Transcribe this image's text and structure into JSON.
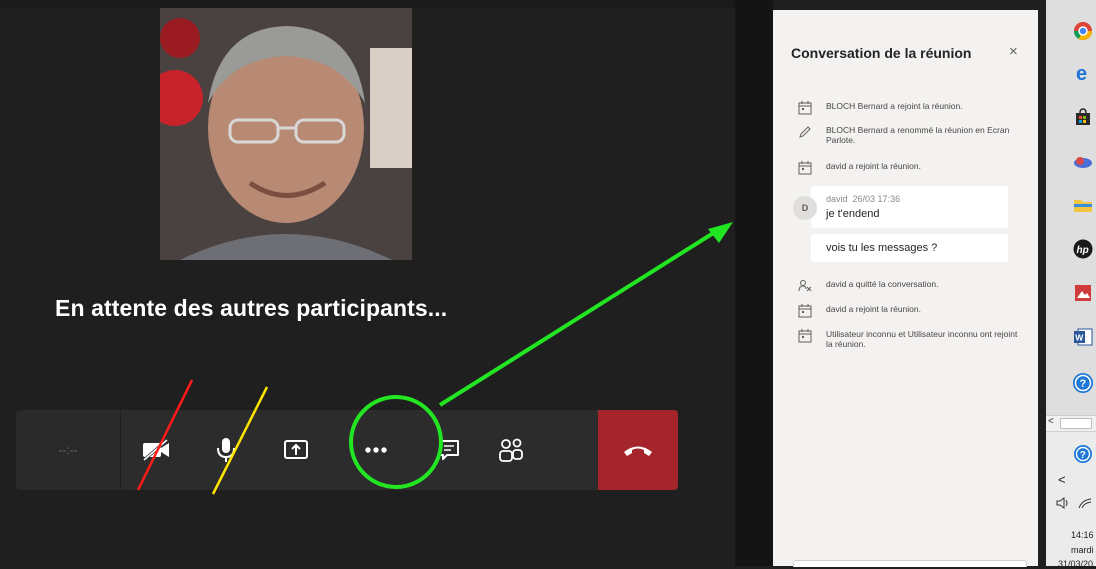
{
  "meeting": {
    "waiting_text": "En attente des autres participants...",
    "timer_text": "--:--"
  },
  "toolbar": {
    "buttons": [
      "camera-off",
      "microphone",
      "share-screen",
      "more-options",
      "chat",
      "participants",
      "hang-up"
    ]
  },
  "chat": {
    "title": "Conversation de la réunion",
    "close_symbol": "×",
    "events": [
      {
        "icon": "calendar-icon",
        "text": "BLOCH Bernard a rejoint la réunion."
      },
      {
        "icon": "pencil-icon",
        "text": "BLOCH Bernard a renommé la réunion en Ecran Parlote."
      },
      {
        "icon": "calendar-icon",
        "text": "david a rejoint la réunion."
      }
    ],
    "message": {
      "avatar_letter": "D",
      "author": "david",
      "time": "26/03 17:36",
      "text": "je t'endend"
    },
    "message2": {
      "text": "vois tu les messages ?"
    },
    "events2": [
      {
        "icon": "leave-icon",
        "text": "david a quitté la conversation."
      },
      {
        "icon": "calendar-icon",
        "text": "david a rejoint la réunion."
      },
      {
        "icon": "calendar-icon",
        "text": "Utilisateur inconnu et Utilisateur inconnu ont rejoint la réunion."
      }
    ]
  },
  "taskbar": {
    "apps": [
      "chrome-icon",
      "edge-icon",
      "store-icon",
      "cloud-icon",
      "file-explorer-icon",
      "hp-icon",
      "image-icon",
      "word-icon",
      "help-icon"
    ],
    "help_icon": "help-icon",
    "back_symbol": "<",
    "time": "14:16",
    "day": "mardi",
    "date": "31/03/20"
  },
  "colors": {
    "annotation_green": "#22e622",
    "strike_red": "#ff1a1a",
    "strike_yellow": "#ffe600",
    "hangup": "#a4262c"
  }
}
